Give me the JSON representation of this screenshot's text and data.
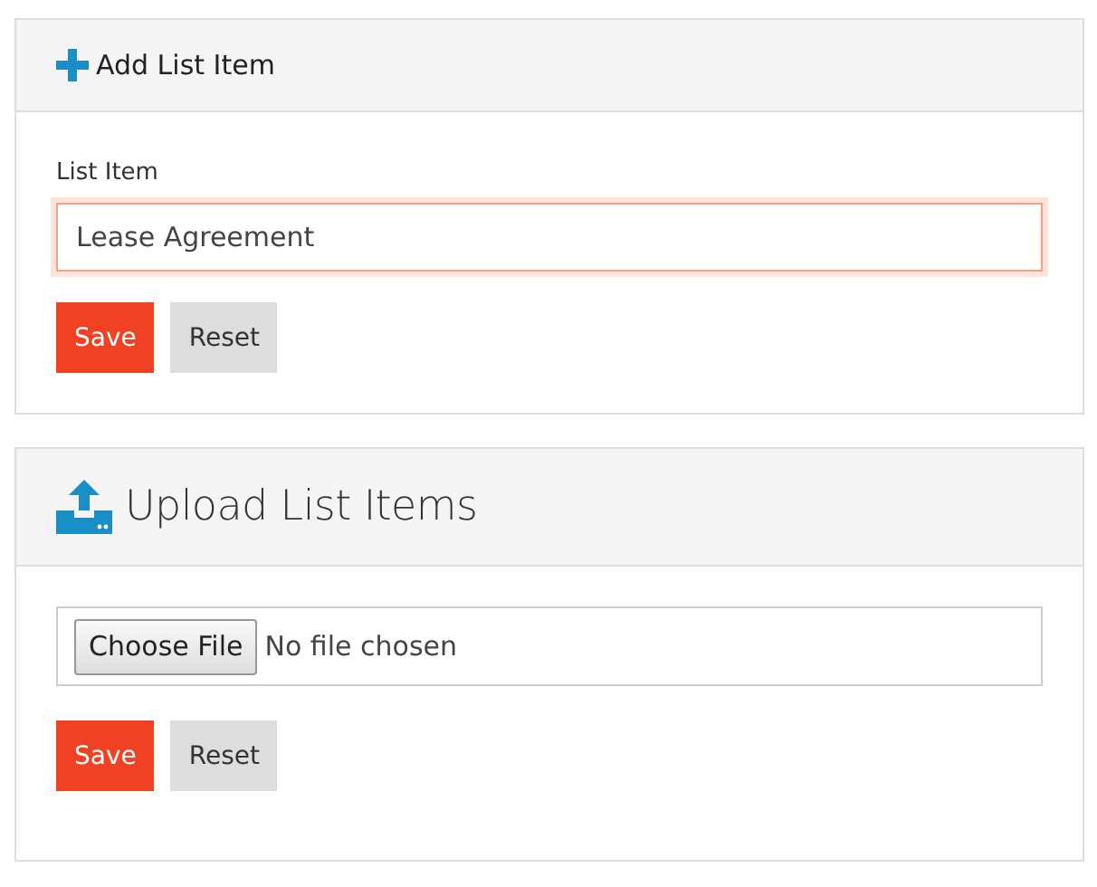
{
  "add_panel": {
    "title": "Add List Item",
    "field": {
      "label": "List Item",
      "value": "Lease Agreement",
      "focused": true
    },
    "buttons": [
      {
        "label": "Save",
        "kind": "primary"
      },
      {
        "label": "Reset",
        "kind": "secondary"
      }
    ]
  },
  "upload_panel": {
    "title": "Upload List Items",
    "file": {
      "button": "Choose File",
      "status": "No file chosen"
    },
    "buttons": [
      {
        "label": "Save",
        "kind": "primary"
      },
      {
        "label": "Reset",
        "kind": "secondary"
      }
    ]
  }
}
